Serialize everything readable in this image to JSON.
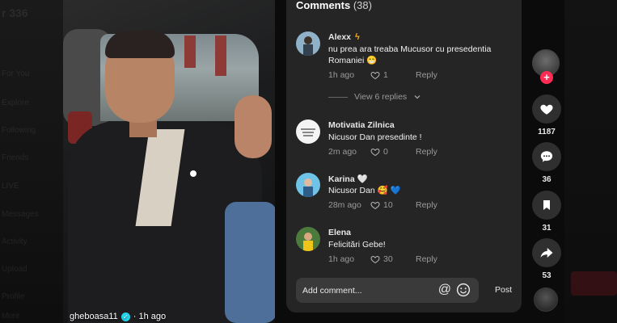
{
  "comments_header": {
    "title": "Comments",
    "count": "(38)"
  },
  "comments": [
    {
      "user": "Alexx",
      "badge_icon": "lightning-icon",
      "text": "nu prea ara treaba Mucusor cu presedentia Romaniei 😁",
      "time": "1h ago",
      "likes": "1",
      "reply": "Reply"
    },
    {
      "user": "Motivatia Zilnica",
      "text": "Nicusor Dan presedinte !",
      "time": "2m ago",
      "likes": "0",
      "reply": "Reply"
    },
    {
      "user": "Karina 🤍",
      "text": "Nicusor Dan 🥰 💙",
      "time": "28m ago",
      "likes": "10",
      "reply": "Reply"
    },
    {
      "user": "Elena",
      "text": "Felicitări Gebe!",
      "time": "1h ago",
      "likes": "30",
      "reply": "Reply"
    }
  ],
  "view_replies": "View 6 replies",
  "add_comment": {
    "placeholder": "Add comment...",
    "post": "Post"
  },
  "video": {
    "author": "gheboasa11",
    "time": "· 1h ago"
  },
  "rail": {
    "likes": "1187",
    "comments": "36",
    "saves": "31",
    "shares": "53",
    "follow": "+"
  },
  "colors": {
    "accent": "#fe2c55",
    "panel": "#252525",
    "verify": "#20d5ec"
  },
  "background_ghost_text": [
    "r 336",
    "For You",
    "Explore",
    "Following",
    "Friends",
    "LIVE",
    "Messages",
    "Activity",
    "Upload",
    "Profile",
    "More"
  ]
}
